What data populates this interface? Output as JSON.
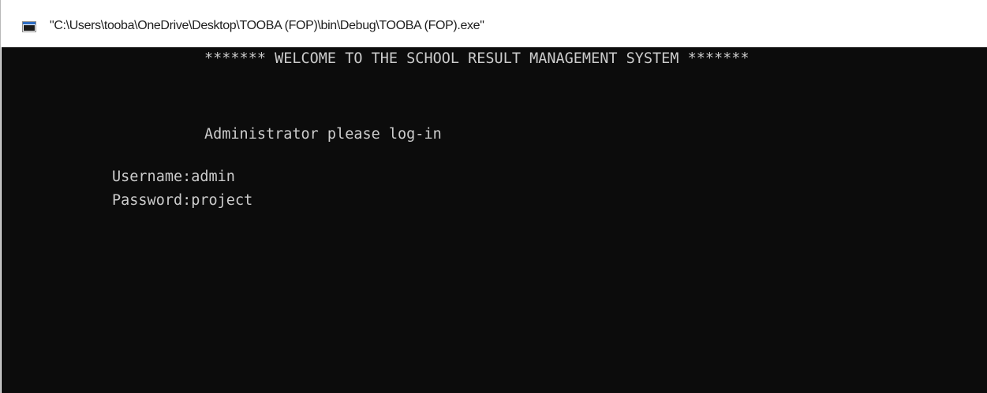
{
  "window": {
    "title": "\"C:\\Users\\tooba\\OneDrive\\Desktop\\TOOBA (FOP)\\bin\\Debug\\TOOBA (FOP).exe\"",
    "icon": "console-window-icon"
  },
  "console": {
    "welcome": "******* WELCOME TO THE SCHOOL RESULT MANAGEMENT SYSTEM *******",
    "prompt": "Administrator please log-in",
    "username_label": "Username:",
    "username_value": "admin",
    "password_label": "Password:",
    "password_value": "project",
    "background_color": "#0c0c0c",
    "text_color": "#cccccc"
  }
}
